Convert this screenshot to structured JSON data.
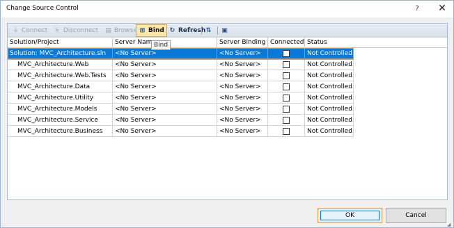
{
  "window": {
    "title": "Change Source Control"
  },
  "titlebar": {
    "help": "?",
    "close": "✕"
  },
  "toolbar": {
    "connect": "Connect",
    "disconnect": "Disconnect",
    "browse": "Browse...",
    "bind": "Bind",
    "refresh": "Refresh"
  },
  "tooltip": "Bind",
  "grid": {
    "columns": [
      "Solution/Project",
      "Server Name",
      "Server Binding",
      "Connected",
      "Status"
    ],
    "rows": [
      {
        "project": "Solution: MVC_Architecture.sln",
        "server_name": "<No Server>",
        "server_binding": "<No Server>",
        "connected": false,
        "status": "Not Controlled"
      },
      {
        "project": "MVC_Architecture.Web",
        "server_name": "<No Server>",
        "server_binding": "<No Server>",
        "connected": false,
        "status": "Not Controlled"
      },
      {
        "project": "MVC_Architecture.Web.Tests",
        "server_name": "<No Server>",
        "server_binding": "<No Server>",
        "connected": false,
        "status": "Not Controlled"
      },
      {
        "project": "MVC_Architecture.Data",
        "server_name": "<No Server>",
        "server_binding": "<No Server>",
        "connected": false,
        "status": "Not Controlled"
      },
      {
        "project": "MVC_Architecture.Utility",
        "server_name": "<No Server>",
        "server_binding": "<No Server>",
        "connected": false,
        "status": "Not Controlled"
      },
      {
        "project": "MVC_Architecture.Models",
        "server_name": "<No Server>",
        "server_binding": "<No Server>",
        "connected": false,
        "status": "Not Controlled"
      },
      {
        "project": "MVC_Architecture.Service",
        "server_name": "<No Server>",
        "server_binding": "<No Server>",
        "connected": false,
        "status": "Not Controlled"
      },
      {
        "project": "MVC_Architecture.Business",
        "server_name": "<No Server>",
        "server_binding": "<No Server>",
        "connected": false,
        "status": "Not Controlled"
      }
    ]
  },
  "buttons": {
    "ok": "OK",
    "cancel": "Cancel"
  }
}
